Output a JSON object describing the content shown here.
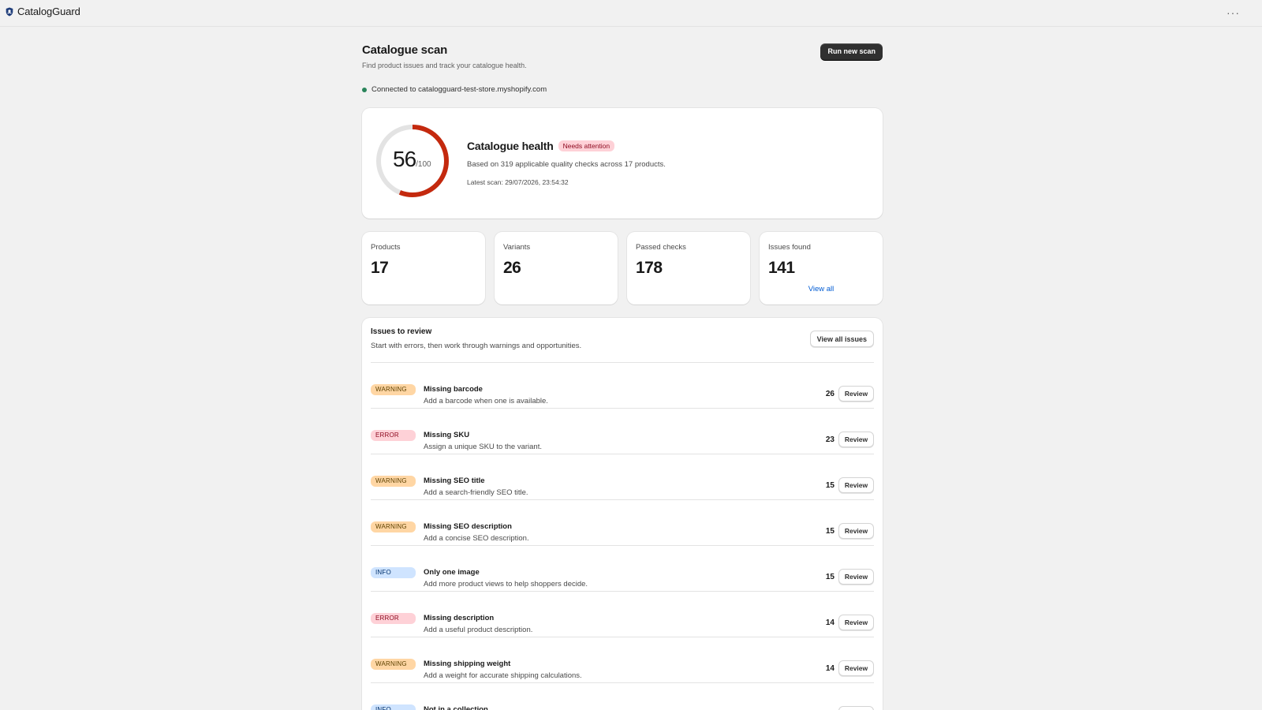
{
  "app": {
    "name": "CatalogGuard",
    "logo_icon": "shield-icon",
    "menu_icon": "more-horizontal-icon"
  },
  "page": {
    "title": "Catalogue scan",
    "subtitle": "Find product issues and track your catalogue health.",
    "run_scan_label": "Run new scan"
  },
  "connection": {
    "text": "Connected to catalogguard-test-store.myshopify.com",
    "status_color": "#29845a"
  },
  "health": {
    "score": "56",
    "score_total": "/100",
    "score_fraction": 0.56,
    "title": "Catalogue health",
    "badge": "Needs attention",
    "description": "Based on 319 applicable quality checks across 17 products.",
    "latest_scan": "Latest scan: 29/07/2026, 23:54:32",
    "gauge_color": "#c4290e"
  },
  "stats": [
    {
      "label": "Products",
      "value": "17"
    },
    {
      "label": "Variants",
      "value": "26"
    },
    {
      "label": "Passed checks",
      "value": "178"
    },
    {
      "label": "Issues found",
      "value": "141",
      "link": "View all"
    }
  ],
  "issues": {
    "title": "Issues to review",
    "subtitle": "Start with errors, then work through warnings and opportunities.",
    "view_all_label": "View all issues",
    "review_label": "Review",
    "rows": [
      {
        "severity": "WARNING",
        "name": "Missing barcode",
        "desc": "Add a barcode when one is available.",
        "count": "26"
      },
      {
        "severity": "ERROR",
        "name": "Missing SKU",
        "desc": "Assign a unique SKU to the variant.",
        "count": "23"
      },
      {
        "severity": "WARNING",
        "name": "Missing SEO title",
        "desc": "Add a search-friendly SEO title.",
        "count": "15"
      },
      {
        "severity": "WARNING",
        "name": "Missing SEO description",
        "desc": "Add a concise SEO description.",
        "count": "15"
      },
      {
        "severity": "INFO",
        "name": "Only one image",
        "desc": "Add more product views to help shoppers decide.",
        "count": "15"
      },
      {
        "severity": "ERROR",
        "name": "Missing description",
        "desc": "Add a useful product description.",
        "count": "14"
      },
      {
        "severity": "WARNING",
        "name": "Missing shipping weight",
        "desc": "Add a weight for accurate shipping calculations.",
        "count": "14"
      },
      {
        "severity": "INFO",
        "name": "Not in a collection",
        "desc": "",
        "count": ""
      }
    ]
  }
}
